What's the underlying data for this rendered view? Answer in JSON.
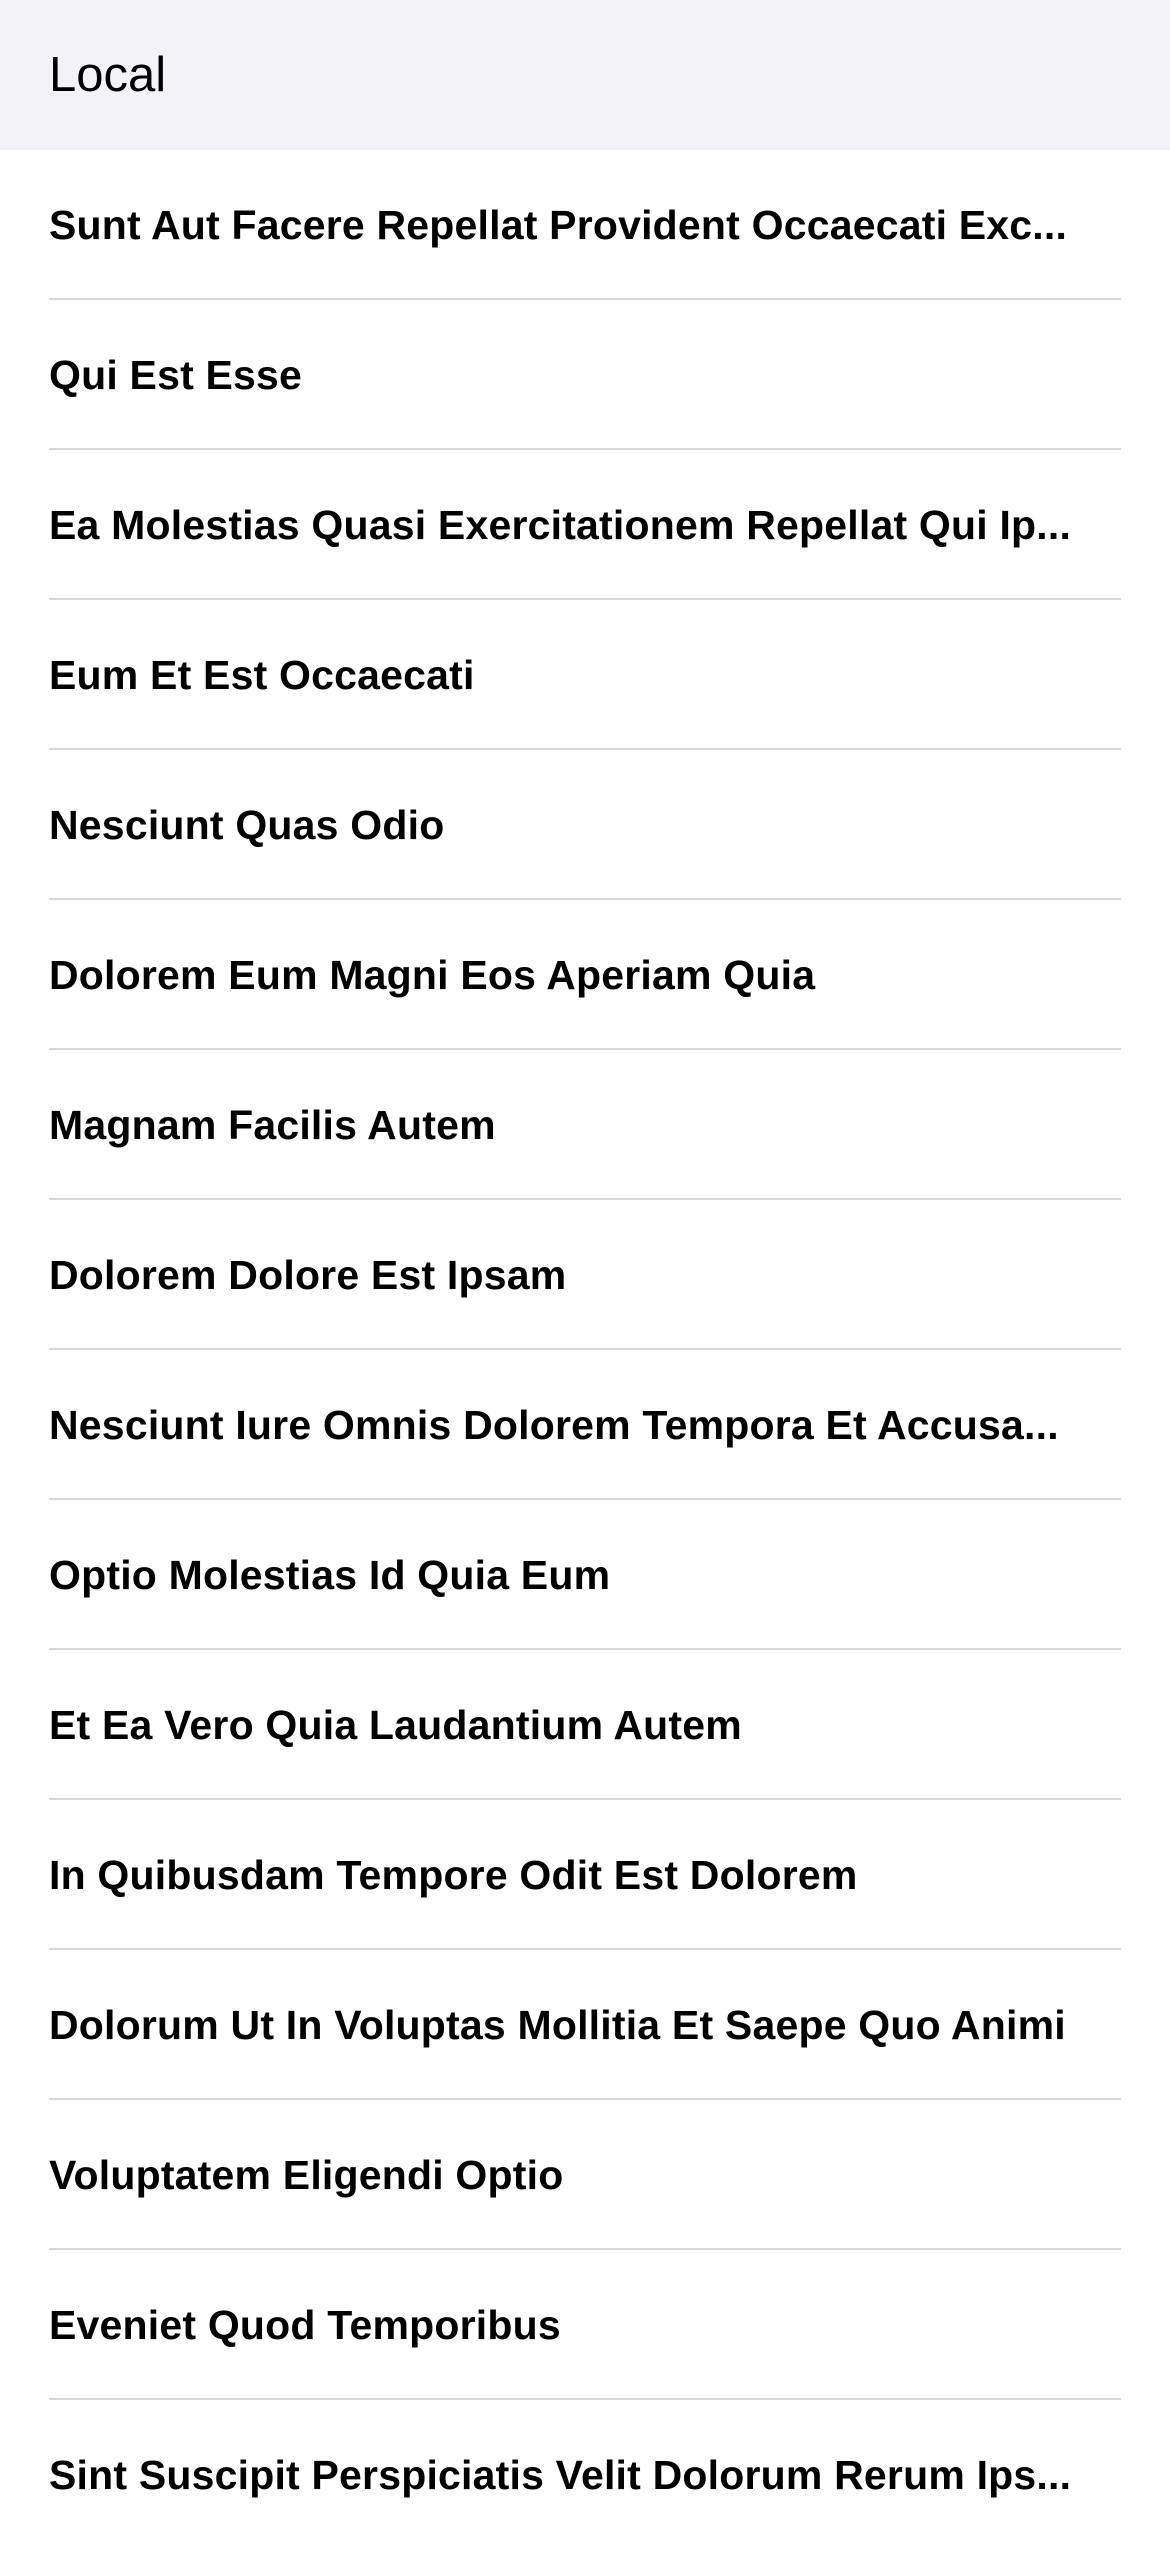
{
  "header": {
    "title": "Local"
  },
  "list": {
    "items": [
      {
        "label": "Sunt Aut Facere Repellat Provident Occaecati Exc..."
      },
      {
        "label": "Qui Est Esse"
      },
      {
        "label": "Ea Molestias Quasi Exercitationem Repellat Qui Ip..."
      },
      {
        "label": "Eum Et Est Occaecati"
      },
      {
        "label": "Nesciunt Quas Odio"
      },
      {
        "label": "Dolorem Eum Magni Eos Aperiam Quia"
      },
      {
        "label": "Magnam Facilis Autem"
      },
      {
        "label": "Dolorem Dolore Est Ipsam"
      },
      {
        "label": "Nesciunt Iure Omnis Dolorem Tempora Et Accusa..."
      },
      {
        "label": "Optio Molestias Id Quia Eum"
      },
      {
        "label": "Et Ea Vero Quia Laudantium Autem"
      },
      {
        "label": "In Quibusdam Tempore Odit Est Dolorem"
      },
      {
        "label": "Dolorum Ut In Voluptas Mollitia Et Saepe Quo Animi"
      },
      {
        "label": "Voluptatem Eligendi Optio"
      },
      {
        "label": "Eveniet Quod Temporibus"
      },
      {
        "label": "Sint Suscipit Perspiciatis Velit Dolorum Rerum Ips..."
      }
    ]
  },
  "colors": {
    "header_background": "#f2f2f7",
    "separator": "#d8d8dc",
    "text": "#000000",
    "background": "#ffffff"
  }
}
